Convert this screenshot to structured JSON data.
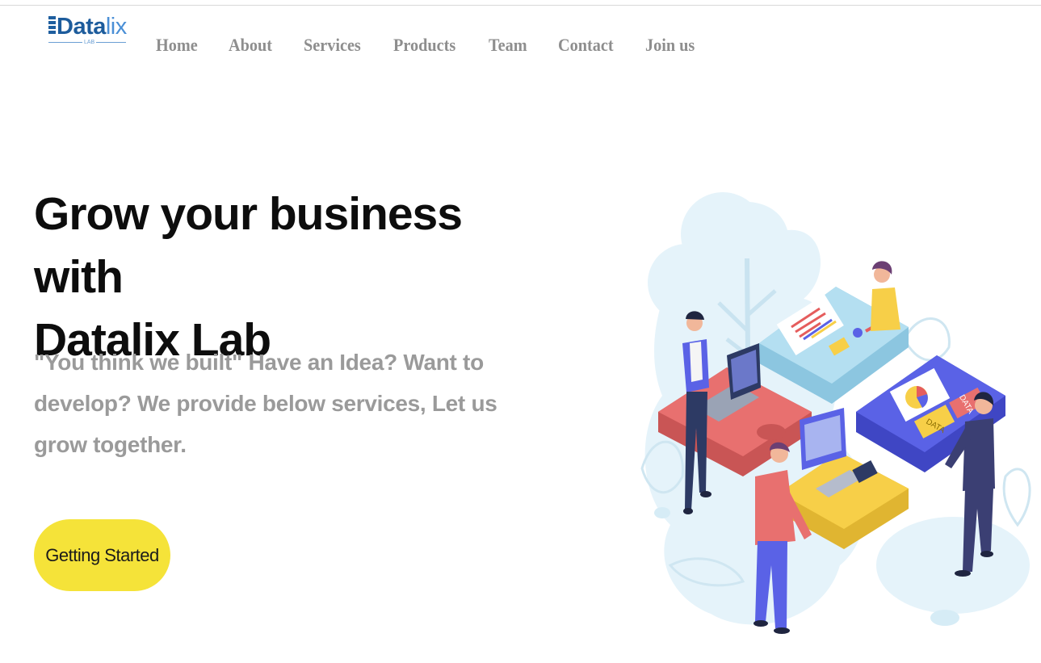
{
  "brand": {
    "name_bold": "Data",
    "name_light": "lix",
    "sub": "LAB",
    "color_primary": "#1d5c9c",
    "color_secondary": "#4a8fd6"
  },
  "nav": {
    "items": [
      "Home",
      "About",
      "Services",
      "Products",
      "Team",
      "Contact",
      "Join us"
    ]
  },
  "hero": {
    "title_line1": "Grow your business with",
    "title_line2": "Datalix Lab",
    "description": "\"You think we built\" Have an Idea? Want to develop? We provide below services, Let us grow together.",
    "cta_label": "Getting Started",
    "cta_color": "#f5e339"
  },
  "illustration": {
    "label_data_1": "DATA",
    "label_data_2": "DATA",
    "colors": {
      "red_piece": "#e8706f",
      "blue_piece": "#5a62e6",
      "light_piece": "#a9d8ee",
      "yellow_piece": "#f7cf48",
      "background_blob": "#e5f3fa"
    }
  }
}
